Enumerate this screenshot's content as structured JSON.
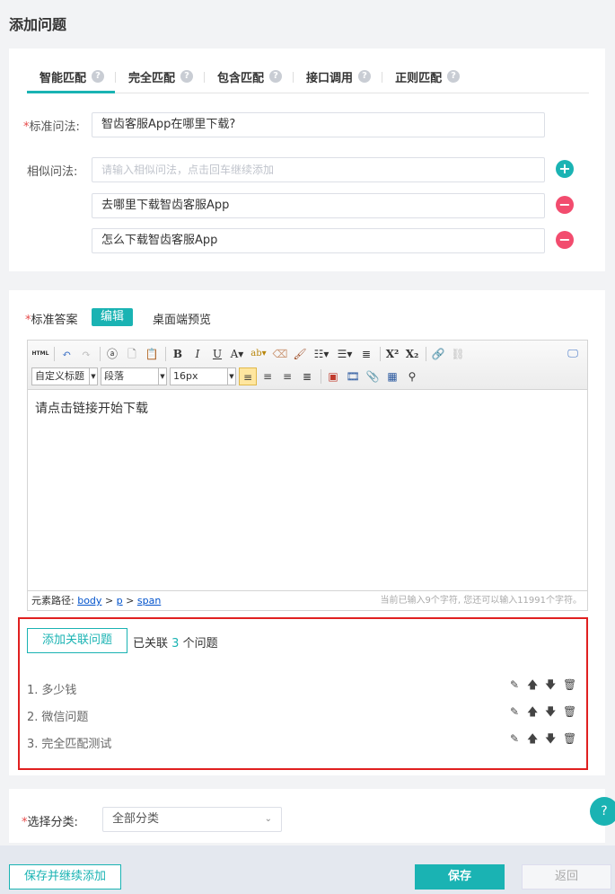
{
  "page_title": "添加问题",
  "tabs": [
    {
      "label": "智能匹配",
      "help": "?"
    },
    {
      "label": "完全匹配",
      "help": "?"
    },
    {
      "label": "包含匹配",
      "help": "?"
    },
    {
      "label": "接口调用",
      "help": "?"
    },
    {
      "label": "正则匹配",
      "help": "?"
    }
  ],
  "standard_question": {
    "label": "标准问法:",
    "required_mark": "*",
    "value": "智齿客服App在哪里下载?"
  },
  "similar": {
    "label": "相似问法:",
    "placeholder": "请输入相似问法，点击回车继续添加",
    "add_symbol": "+",
    "remove_symbol": "−",
    "items": [
      "去哪里下载智齿客服App",
      "怎么下载智齿客服App"
    ]
  },
  "answer": {
    "required_mark": "*",
    "label": "标准答案",
    "mode_edit": "编辑",
    "mode_preview": "桌面端预览",
    "content": "请点击链接开始下载"
  },
  "editor": {
    "html_label": "HTML",
    "custom_title": "自定义标题",
    "paragraph": "段落",
    "font_size": "16px",
    "path_label": "元素路径:",
    "path": [
      "body",
      "p",
      "span"
    ],
    "path_sep": ">",
    "char_count": "当前已输入9个字符, 您还可以输入11991个字符。"
  },
  "related": {
    "button": "添加关联问题",
    "prefix": "已关联",
    "count": "3",
    "suffix": "个问题",
    "items": [
      {
        "no": "1.",
        "text": "多少钱"
      },
      {
        "no": "2.",
        "text": "微信问题"
      },
      {
        "no": "3.",
        "text": "完全匹配测试"
      }
    ]
  },
  "category": {
    "required_mark": "*",
    "label": "选择分类:",
    "value": "全部分类"
  },
  "footer": {
    "save_continue": "保存并继续添加",
    "save": "保存",
    "back": "返回"
  },
  "colors": {
    "accent": "#1ab3b3",
    "danger": "#f24c6e",
    "highlight_border": "#e02020"
  }
}
